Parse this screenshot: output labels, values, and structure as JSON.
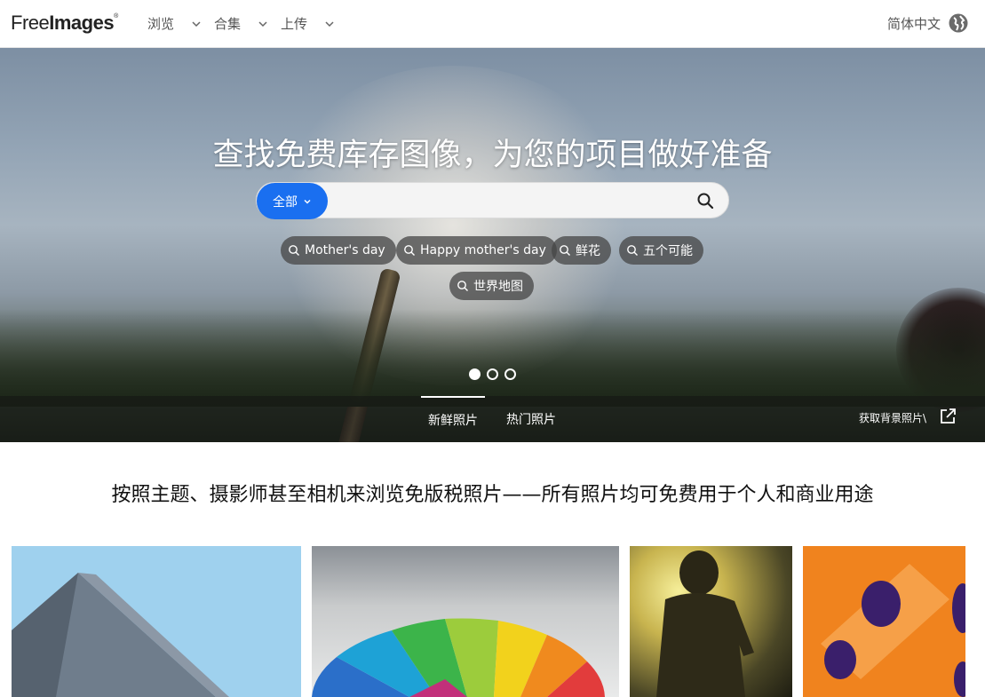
{
  "header": {
    "logo": {
      "light": "Free",
      "bold": "Images",
      "mark": "®"
    },
    "nav": [
      {
        "label": "浏览"
      },
      {
        "label": "合集"
      },
      {
        "label": "上传"
      }
    ],
    "language": "简体中文"
  },
  "hero": {
    "title": "查找免费库存图像，为您的项目做好准备",
    "search": {
      "category": "全部",
      "placeholder": "",
      "value": ""
    },
    "chips": [
      "Mother's day",
      "Happy mother's day",
      "鲜花",
      "五个可能",
      "世界地图"
    ],
    "slide_count": 3,
    "active_slide": 1,
    "tabs": [
      {
        "label": "新鲜照片",
        "active": true
      },
      {
        "label": "热门照片",
        "active": false
      }
    ],
    "background_link": "获取背景照片\\"
  },
  "content": {
    "tagline": "按照主题、摄影师甚至相机来浏览免版税照片——所有照片均可免费用于个人和商业用途"
  },
  "colors": {
    "accent": "#1a6ff0",
    "chip_bg": "#464646",
    "orange_photo": "#f0831e",
    "sky_photo": "#9fd1ee"
  }
}
